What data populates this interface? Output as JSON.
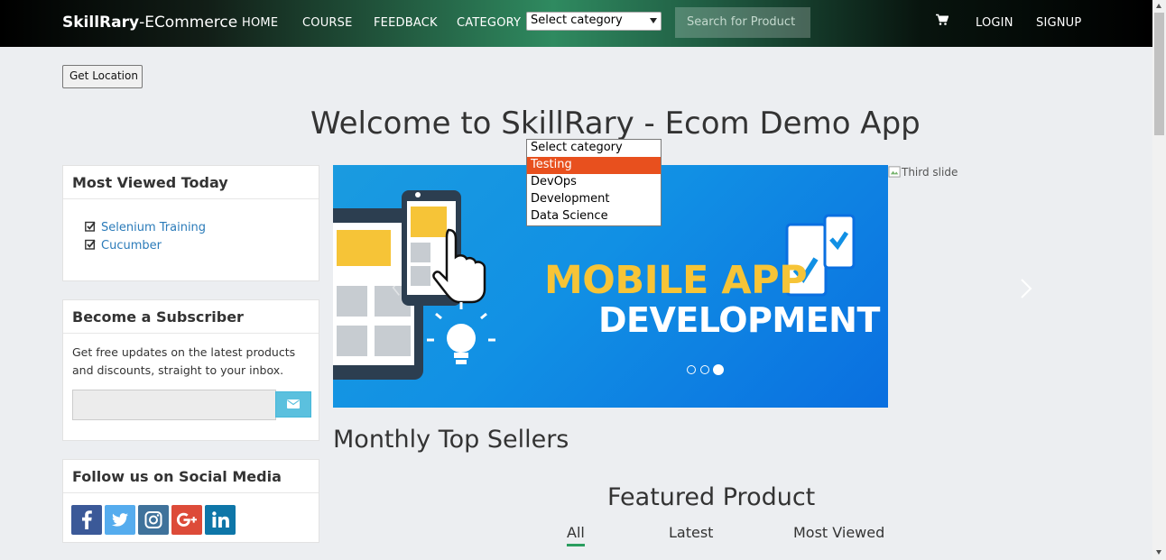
{
  "navbar": {
    "brand_bold": "SkillRary",
    "brand_rest": "-ECommerce",
    "links": [
      "HOME",
      "COURSE",
      "FEEDBACK",
      "CATEGORY"
    ],
    "category_select": "Select category",
    "search_placeholder": "Search for Product",
    "cart_icon": "shopping-cart-icon",
    "login": "LOGIN",
    "signup": "SIGNUP"
  },
  "category_dropdown": {
    "options": [
      "Select category",
      "Testing",
      "DevOps",
      "Development",
      "Data Science"
    ],
    "highlighted": "Testing"
  },
  "get_location": "Get Location",
  "welcome_title": "Welcome to SkillRary - Ecom Demo App",
  "most_viewed": {
    "title": "Most Viewed Today",
    "items": [
      "Selenium Training",
      "Cucumber"
    ]
  },
  "subscriber": {
    "title": "Become a Subscriber",
    "text": "Get free updates on the latest products and discounts, straight to your inbox.",
    "icon": "envelope-icon"
  },
  "social": {
    "title": "Follow us on Social Media",
    "networks": [
      "facebook",
      "twitter",
      "instagram",
      "google-plus",
      "linkedin"
    ]
  },
  "carousel": {
    "line1": "MOBILE APP",
    "line2": "DEVELOPMENT",
    "active_slide": 3,
    "slide_count": 3,
    "third_slide_alt": "Third slide"
  },
  "monthly_title": "Monthly Top Sellers",
  "featured": {
    "title": "Featured Product",
    "tabs": [
      "All",
      "Latest",
      "Most Viewed"
    ],
    "active_tab": "All"
  },
  "colors": {
    "dropdown_highlight": "#e8501e",
    "link": "#2b7bb9",
    "tab_underline": "#2a9d5f",
    "subscribe_button": "#5bc0de"
  }
}
